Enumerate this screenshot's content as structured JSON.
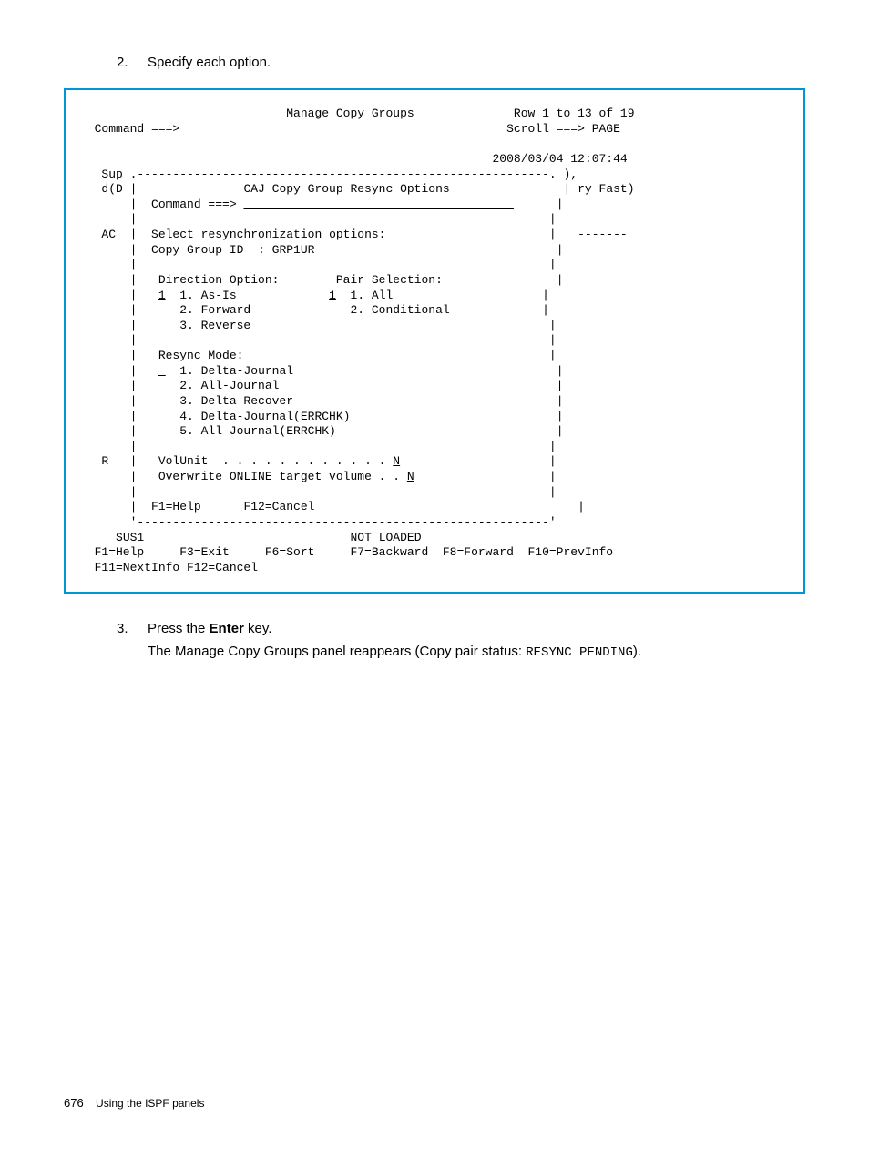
{
  "instructions": {
    "item2": {
      "num": "2.",
      "text": "Specify each option."
    },
    "item3": {
      "num": "3.",
      "text_before": "Press the ",
      "key": "Enter",
      "text_after": " key.",
      "result_before": "The Manage Copy Groups panel reappears (Copy pair status: ",
      "status": "RESYNC PENDING",
      "result_after": ")."
    }
  },
  "terminal": {
    "title": "Manage Copy Groups",
    "row_info": "Row 1 to 13 of 19",
    "command_prompt": "Command ===>",
    "scroll": "Scroll ===> PAGE",
    "datetime": "2008/03/04 12:07:44",
    "left_sup": "   Sup",
    "left_dd": "   d(D",
    "right_paren": "),",
    "right_ry": "ry Fast)",
    "modal_title": "CAJ Copy Group Resync Options",
    "modal_cmd": "Command ===>",
    "modal_underline_spaces": "                                      ",
    "ac_label": "   AC",
    "select_line": "Select resynchronization options:",
    "dashes": "-------",
    "copy_group_id": "Copy Group ID  : GRP1UR",
    "direction_label": "Direction Option:",
    "pair_label": "Pair Selection:",
    "dir1_val": "1",
    "dir1": "1. As-Is",
    "pair1_val": "1",
    "pair1": "1. All",
    "dir2": "2. Forward",
    "pair2": "2. Conditional",
    "dir3": "3. Reverse",
    "resync_label": "Resync Mode:",
    "resync_val": "_",
    "resync1": "1. Delta-Journal",
    "resync2": "2. All-Journal",
    "resync3": "3. Delta-Recover",
    "resync4": "4. Delta-Journal(ERRCHK)",
    "resync5": "5. All-Journal(ERRCHK)",
    "r_label": "   R",
    "volunit": "VolUnit  . . . . . . . . . . . . ",
    "volunit_val": "N",
    "overwrite": "Overwrite ONLINE target volume . . ",
    "overwrite_val": "N",
    "f1": "F1=Help",
    "f12": "F12=Cancel",
    "sus": "SUS1",
    "not_loaded": "NOT LOADED",
    "fkeys_line": "  F1=Help     F3=Exit     F6=Sort     F7=Backward  F8=Forward  F10=PrevInfo",
    "fkeys_line2": "  F11=NextInfo F12=Cancel"
  },
  "footer": {
    "page": "676",
    "title": "Using the ISPF panels"
  }
}
